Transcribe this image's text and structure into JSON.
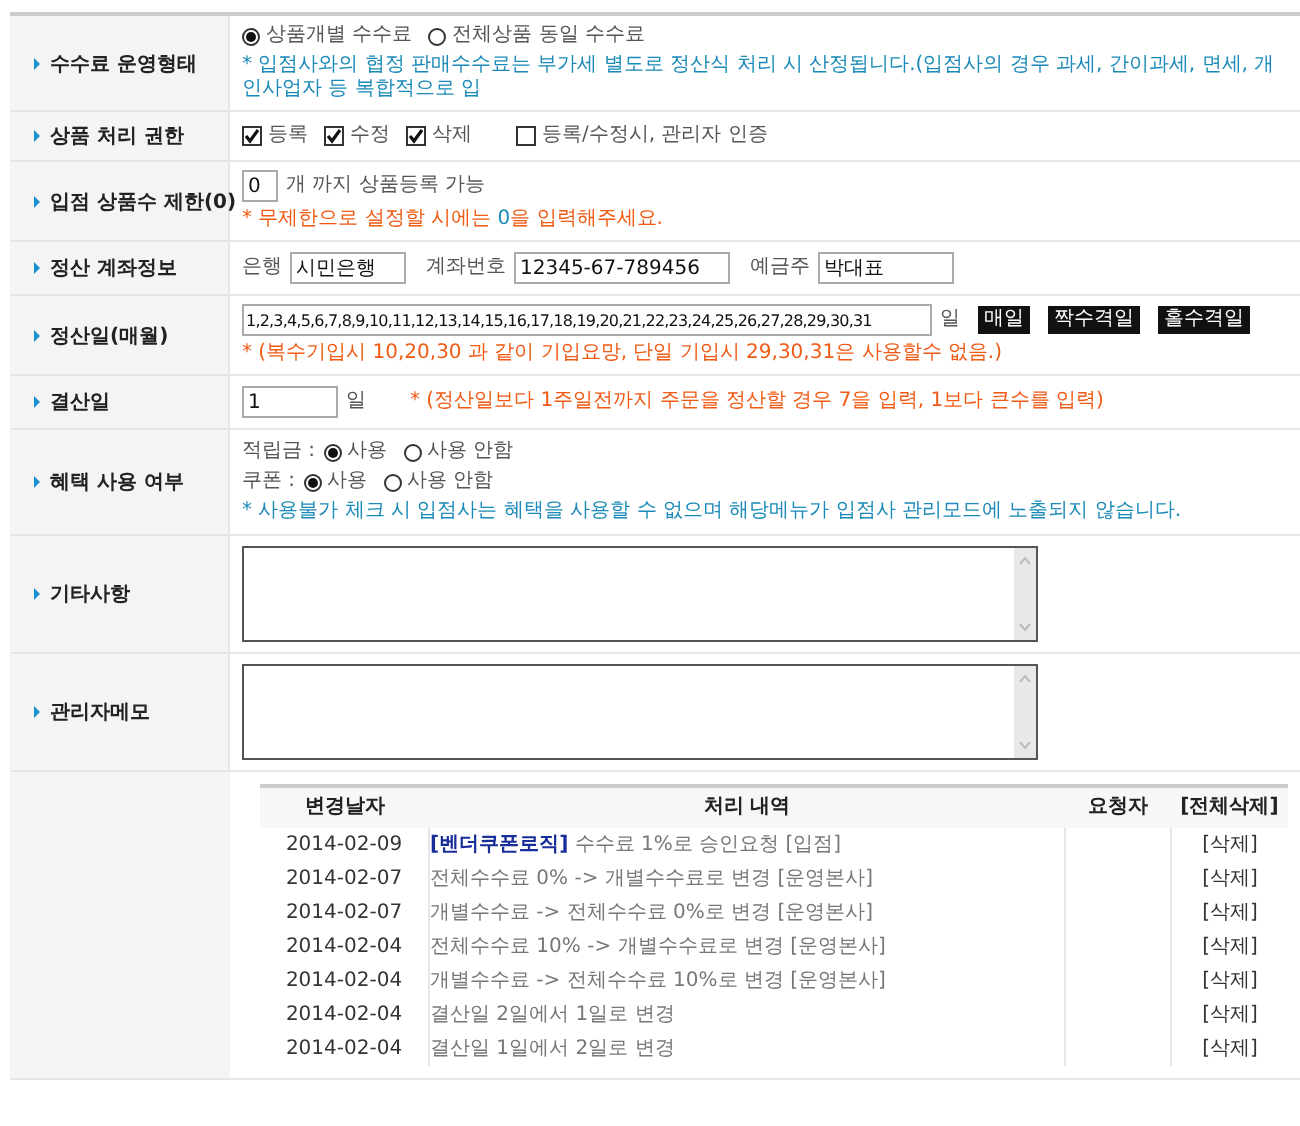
{
  "rows": [
    {
      "kind": "radio_options",
      "label": "수수료 운영형태",
      "options": [
        {
          "label": "상품개별 수수료",
          "selected": true
        },
        {
          "label": "전체상품 동일 수수료",
          "selected": false
        }
      ],
      "note": "* 입점사와의 협정 판매수수료는 부가세 별도로 정산식 처리 시 산정됩니다.(입점사의 경우 과세, 간이과세, 면세, 개인사업자 등 복합적으로 입"
    },
    {
      "kind": "checkboxes",
      "label": "상품 처리 권한",
      "options": [
        {
          "label": "등록",
          "checked": true
        },
        {
          "label": "수정",
          "checked": true
        },
        {
          "label": "삭제",
          "checked": true
        },
        {
          "label": "등록/수정시, 관리자 인증",
          "checked": false
        }
      ]
    },
    {
      "kind": "number_limit",
      "label": "입점 상품수 제한(0)",
      "value": "0",
      "suffix": "개 까지 상품등록 가능",
      "note_before": "* 무제한으로 설정할 시에는 ",
      "note_highlight": "0",
      "note_after": "을 입력해주세요."
    },
    {
      "kind": "account",
      "label": "정산 계좌정보",
      "fields": [
        {
          "label": "은행",
          "value": "시민은행"
        },
        {
          "label": "계좌번호",
          "value": "12345-67-789456"
        },
        {
          "label": "예금주",
          "value": "박대표"
        }
      ]
    },
    {
      "kind": "settlement_days",
      "label": "정산일(매월)",
      "value": "1,2,3,4,5,6,7,8,9,10,11,12,13,14,15,16,17,18,19,20,21,22,23,24,25,26,27,28,29,30,31",
      "suffix": "일",
      "buttons": [
        "매일",
        "짝수격일",
        "홀수격일"
      ],
      "note": "* (복수기입시 10,20,30 과 같이 기입요망, 단일 기입시 29,30,31은 사용할수 없음.)"
    },
    {
      "kind": "closing_day",
      "label": "결산일",
      "value": "1",
      "suffix": "일",
      "note": "* (정산일보다 1주일전까지 주문을 정산할 경우 7을 입력, 1보다 큰수를 입력)"
    },
    {
      "kind": "benefits",
      "label": "혜택 사용 여부",
      "groups": [
        {
          "label": "적립금 :",
          "options": [
            {
              "label": "사용",
              "selected": true
            },
            {
              "label": "사용 안함",
              "selected": false
            }
          ]
        },
        {
          "label": "쿠폰 :",
          "options": [
            {
              "label": "사용",
              "selected": true
            },
            {
              "label": "사용 안함",
              "selected": false
            }
          ]
        }
      ],
      "note": "* 사용불가 체크 시 입점사는 혜택을 사용할 수 없으며 해당메뉴가 입점사 관리모드에 노출되지 않습니다."
    },
    {
      "kind": "textarea",
      "label": "기타사항"
    },
    {
      "kind": "textarea",
      "label": "관리자메모"
    },
    {
      "kind": "history",
      "columns": [
        "변경날자",
        "처리 내역",
        "요청자",
        "[전체삭제]"
      ],
      "entries": [
        {
          "date": "2014-02-09",
          "tag": "[벤더쿠폰로직]",
          "text": "수수료 1%로 승인요청 [입점]",
          "action": "[삭제]"
        },
        {
          "date": "2014-02-07",
          "text": "전체수수료 0% -> 개별수수료로 변경 [운영본사]",
          "action": "[삭제]"
        },
        {
          "date": "2014-02-07",
          "text": "개별수수료 -> 전체수수료 0%로 변경 [운영본사]",
          "action": "[삭제]"
        },
        {
          "date": "2014-02-04",
          "text": "전체수수료 10% -> 개별수수료로 변경 [운영본사]",
          "action": "[삭제]"
        },
        {
          "date": "2014-02-04",
          "text": "개별수수료 -> 전체수수료 10%로 변경 [운영본사]",
          "action": "[삭제]"
        },
        {
          "date": "2014-02-04",
          "text": "결산일 2일에서 1일로 변경",
          "action": "[삭제]"
        },
        {
          "date": "2014-02-04",
          "text": "결산일 1일에서 2일로 변경",
          "action": "[삭제]"
        }
      ]
    }
  ]
}
